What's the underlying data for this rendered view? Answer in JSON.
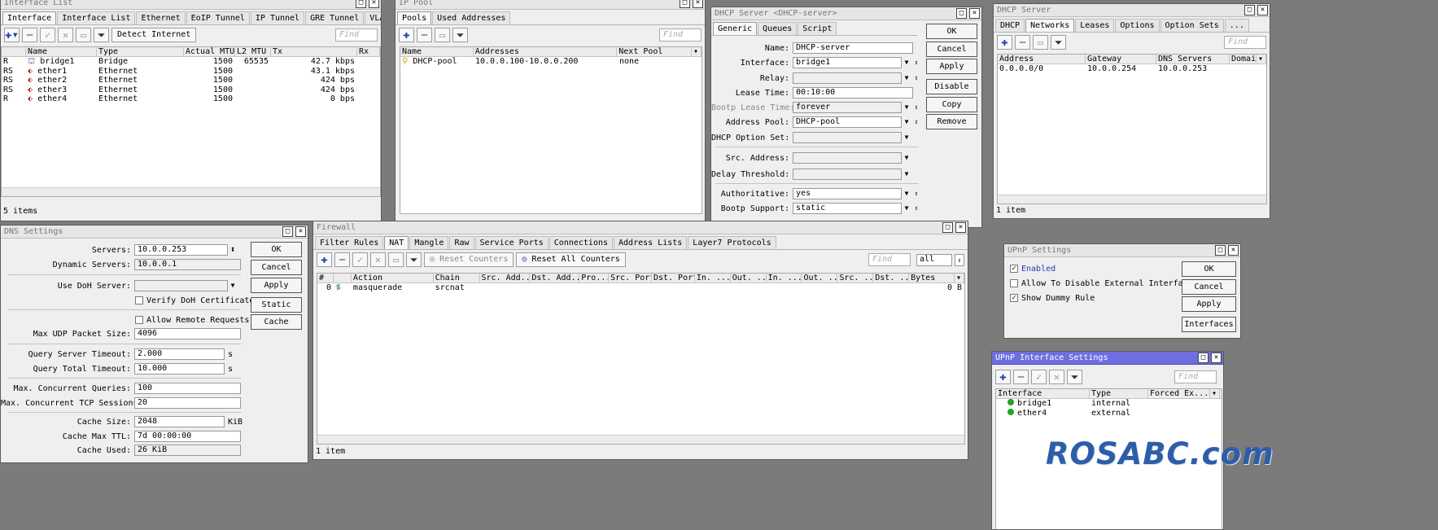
{
  "iface": {
    "title": "Interface List",
    "tabs": [
      "Interface",
      "Interface List",
      "Ethernet",
      "EoIP Tunnel",
      "IP Tunnel",
      "GRE Tunnel",
      "VLAN",
      "..."
    ],
    "detect": "Detect Internet",
    "find": "Find",
    "headers": [
      "",
      "Name",
      "Type",
      "Actual MTU",
      "L2 MTU",
      "Tx",
      "Rx"
    ],
    "rows": [
      {
        "flag": "R",
        "name": "bridge1",
        "type": "Bridge",
        "mtu": "1500",
        "l2": "65535",
        "tx": "42.7 kbps"
      },
      {
        "flag": "RS",
        "name": "ether1",
        "type": "Ethernet",
        "mtu": "1500",
        "l2": "",
        "tx": "43.1 kbps"
      },
      {
        "flag": "RS",
        "name": "ether2",
        "type": "Ethernet",
        "mtu": "1500",
        "l2": "",
        "tx": "424 bps"
      },
      {
        "flag": "RS",
        "name": "ether3",
        "type": "Ethernet",
        "mtu": "1500",
        "l2": "",
        "tx": "424 bps"
      },
      {
        "flag": "R",
        "name": "ether4",
        "type": "Ethernet",
        "mtu": "1500",
        "l2": "",
        "tx": "0 bps"
      }
    ],
    "status": "5 items"
  },
  "pool": {
    "title": "IP Pool",
    "tabs": [
      "Pools",
      "Used Addresses"
    ],
    "find": "Find",
    "headers": [
      "Name",
      "Addresses",
      "Next Pool"
    ],
    "rows": [
      {
        "name": "DHCP-pool",
        "addresses": "10.0.0.100-10.0.0.200",
        "next": "none"
      }
    ]
  },
  "dhcp": {
    "title": "DHCP Server <DHCP-server>",
    "tabs": [
      "Generic",
      "Queues",
      "Script"
    ],
    "labels": {
      "name": "Name:",
      "interface": "Interface:",
      "relay": "Relay:",
      "lease": "Lease Time:",
      "bootp_lease": "Bootp Lease Time:",
      "pool": "Address Pool:",
      "option_set": "DHCP Option Set:",
      "src": "Src. Address:",
      "delay": "Delay Threshold:",
      "auth": "Authoritative:",
      "bootp": "Bootp Support:"
    },
    "values": {
      "name": "DHCP-server",
      "interface": "bridge1",
      "relay": "",
      "lease": "00:10:00",
      "bootp_lease": "forever",
      "pool": "DHCP-pool",
      "option_set": "",
      "src": "",
      "delay": "",
      "auth": "yes",
      "bootp": "static"
    },
    "buttons": [
      "OK",
      "Cancel",
      "Apply",
      "Disable",
      "Copy",
      "Remove"
    ]
  },
  "dhcpsrv": {
    "title": "DHCP Server",
    "tabs": [
      "DHCP",
      "Networks",
      "Leases",
      "Options",
      "Option Sets",
      "..."
    ],
    "find": "Find",
    "headers": [
      "Address",
      "Gateway",
      "DNS Servers",
      "Domain"
    ],
    "rows": [
      {
        "address": "0.0.0.0/0",
        "gateway": "10.0.0.254",
        "dns": "10.0.0.253",
        "domain": ""
      }
    ],
    "status": "1 item"
  },
  "dns": {
    "title": "DNS Settings",
    "labels": {
      "servers": "Servers:",
      "dynamic": "Dynamic Servers:",
      "doh": "Use DoH Server:",
      "verify": "Verify DoH Certificate",
      "allow": "Allow Remote Requests",
      "udp": "Max UDP Packet Size:",
      "qst": "Query Server Timeout:",
      "qtt": "Query Total Timeout:",
      "mcq": "Max. Concurrent Queries:",
      "mcts": "Max. Concurrent TCP Sessions:",
      "csize": "Cache Size:",
      "cttl": "Cache Max TTL:",
      "cused": "Cache Used:"
    },
    "values": {
      "servers": "10.0.0.253",
      "dynamic": "10.0.0.1",
      "doh": "",
      "udp": "4096",
      "qst": "2.000",
      "qtt": "10.000",
      "mcq": "100",
      "mcts": "20",
      "csize": "2048",
      "cttl": "7d 00:00:00",
      "cused": "26 KiB"
    },
    "units": {
      "s": "s",
      "kib": "KiB"
    },
    "buttons": [
      "OK",
      "Cancel",
      "Apply",
      "Static",
      "Cache"
    ]
  },
  "fw": {
    "title": "Firewall",
    "tabs": [
      "Filter Rules",
      "NAT",
      "Mangle",
      "Raw",
      "Service Ports",
      "Connections",
      "Address Lists",
      "Layer7 Protocols"
    ],
    "reset": "Reset Counters",
    "reset_all": "Reset All Counters",
    "find": "Find",
    "filter_value": "all",
    "headers": [
      "#",
      "",
      "Action",
      "Chain",
      "Src. Add...",
      "Dst. Add...",
      "Pro...",
      "Src. Port",
      "Dst. Port",
      "In. ...",
      "Out. ...",
      "In. ...",
      "Out. ...",
      "Src. ...",
      "Dst. ...",
      "Bytes"
    ],
    "rows": [
      {
        "num": "0",
        "action": "masquerade",
        "chain": "srcnat",
        "bytes": "0 B"
      }
    ],
    "status": "1 item"
  },
  "upnp": {
    "title": "UPnP Settings",
    "enabled": "Enabled",
    "allow_disable": "Allow To Disable External Interface",
    "dummy": "Show Dummy Rule",
    "buttons": [
      "OK",
      "Cancel",
      "Apply",
      "Interfaces"
    ]
  },
  "upnpif": {
    "title": "UPnP Interface Settings",
    "find": "Find",
    "headers": [
      "Interface",
      "Type",
      "Forced Ex..."
    ],
    "rows": [
      {
        "iface": "bridge1",
        "type": "internal"
      },
      {
        "iface": "ether4",
        "type": "external"
      }
    ]
  },
  "watermark": "ROSABC.com"
}
